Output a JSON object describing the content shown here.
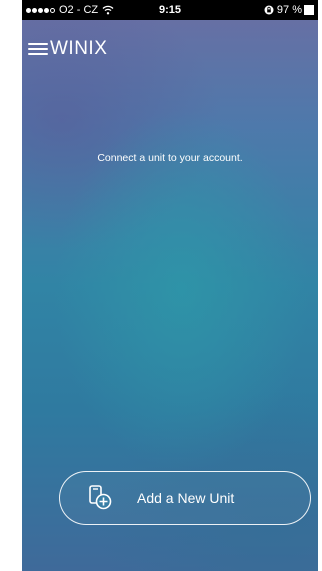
{
  "status_bar": {
    "carrier": "O2 - CZ",
    "time": "9:15",
    "battery": "97 %",
    "icons": [
      "signal-dots",
      "wifi-icon",
      "lock-icon",
      "battery-icon"
    ]
  },
  "header": {
    "title": "WINIX",
    "menu_icon": "hamburger-menu-icon"
  },
  "main": {
    "message": "Connect a unit to your account."
  },
  "add_unit_button": {
    "label": "Add a New Unit",
    "icon": "add-device-icon"
  },
  "colors": {
    "background_top": "#6b6ea3",
    "background_mid": "#3184a5",
    "background_bottom": "#3f6a9a",
    "text": "#ffffff",
    "status_bar": "#000000"
  }
}
